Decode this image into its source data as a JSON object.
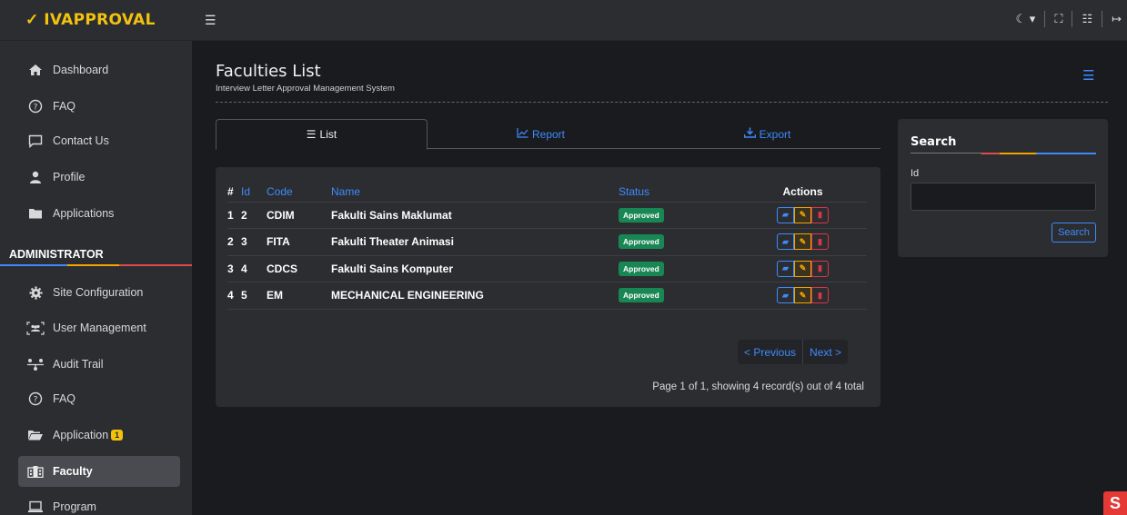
{
  "brand": {
    "name": "IVAPPROVAL",
    "mark": "✓"
  },
  "sidebar": {
    "items_top": [
      {
        "label": "Dashboard",
        "icon": "home-icon"
      },
      {
        "label": "FAQ",
        "icon": "question-circle-icon"
      },
      {
        "label": "Contact Us",
        "icon": "chat-icon"
      },
      {
        "label": "Profile",
        "icon": "user-icon"
      },
      {
        "label": "Applications",
        "icon": "folder-icon"
      }
    ],
    "section": "ADMINISTRATOR",
    "items_admin": [
      {
        "label": "Site Configuration",
        "icon": "gear-icon"
      },
      {
        "label": "User Management",
        "icon": "users-icon"
      },
      {
        "label": "Audit Trail",
        "icon": "diagram-icon"
      },
      {
        "label": "FAQ",
        "icon": "question-circle-icon"
      },
      {
        "label": "Application",
        "icon": "folder-open-icon",
        "badge": "1"
      },
      {
        "label": "Faculty",
        "icon": "building-icon",
        "active": true
      },
      {
        "label": "Program",
        "icon": "laptop-icon"
      }
    ]
  },
  "header": {
    "title": "Faculties List",
    "subtitle": "Interview Letter Approval Management System"
  },
  "tabs": [
    {
      "label": "List",
      "icon": "list-icon",
      "active": true
    },
    {
      "label": "Report",
      "icon": "chart-line-icon"
    },
    {
      "label": "Export",
      "icon": "download-icon"
    }
  ],
  "table": {
    "headers": [
      "#",
      "Id",
      "Code",
      "Name",
      "Status",
      "Actions"
    ],
    "rows": [
      {
        "n": "1",
        "id": "2",
        "code": "CDIM",
        "name": "Fakulti Sains Maklumat",
        "status": "Approved"
      },
      {
        "n": "2",
        "id": "3",
        "code": "FITA",
        "name": "Fakulti Theater Animasi",
        "status": "Approved"
      },
      {
        "n": "3",
        "id": "4",
        "code": "CDCS",
        "name": "Fakulti Sains Komputer",
        "status": "Approved"
      },
      {
        "n": "4",
        "id": "5",
        "code": "EM",
        "name": "MECHANICAL ENGINEERING",
        "status": "Approved"
      }
    ]
  },
  "pager": {
    "prev": "< Previous",
    "next": "Next >",
    "info": "Page 1 of 1, showing 4 record(s) out of 4 total"
  },
  "search": {
    "title": "Search",
    "id_label": "Id",
    "id_value": "",
    "button": "Search"
  },
  "colors": {
    "accent": "#3d8bfd",
    "brand": "#f2c20e",
    "success": "#198754",
    "danger": "#dc3545",
    "warning": "#f0a500"
  }
}
